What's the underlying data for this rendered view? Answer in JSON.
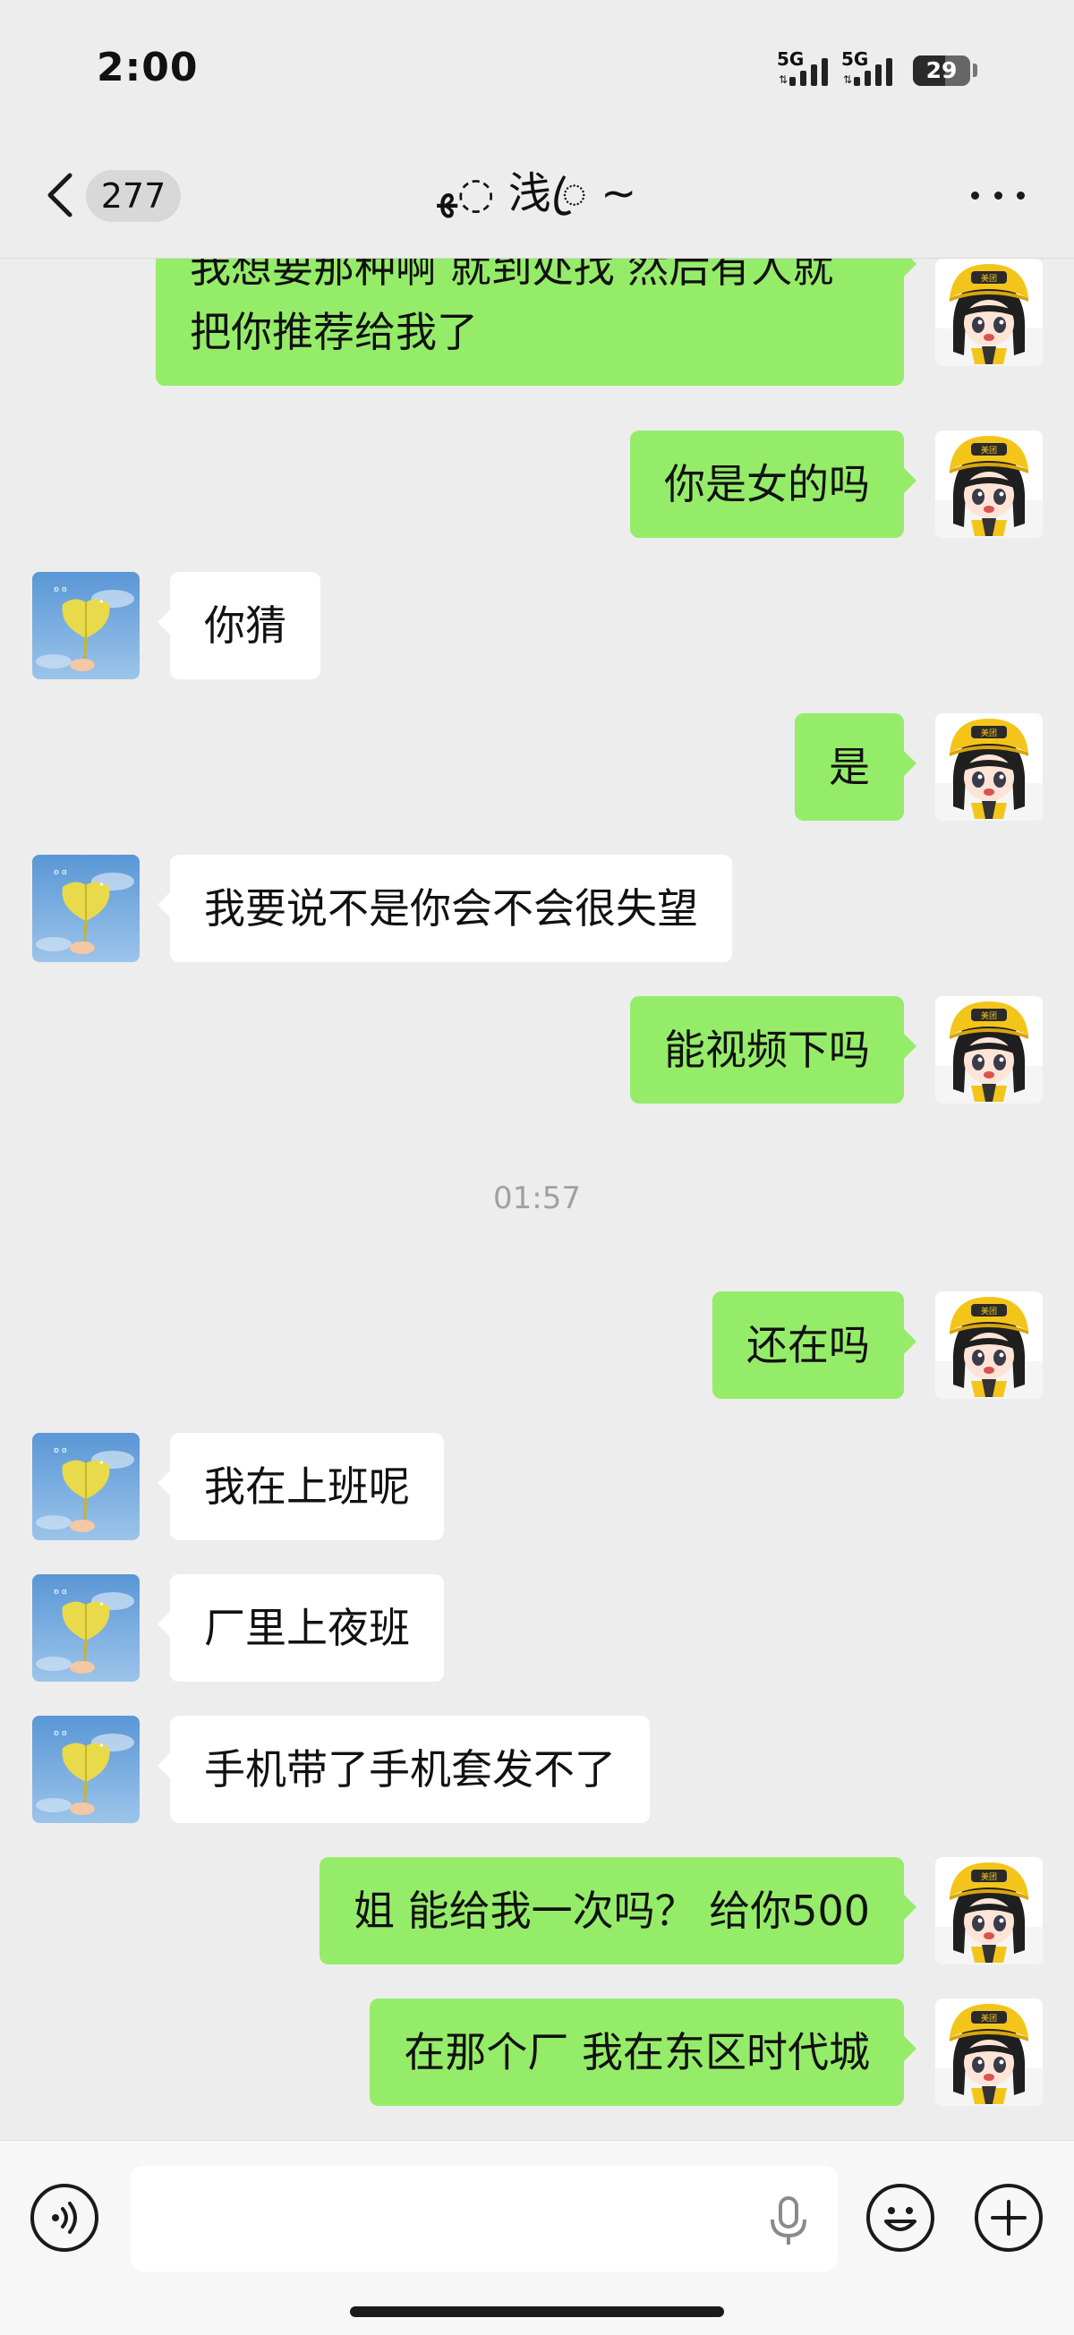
{
  "status_bar": {
    "time": "2:00",
    "sim1_label": "5G",
    "sim2_label": "5G",
    "battery_level": "29"
  },
  "header": {
    "unread_count": "277",
    "title": "ﻬ◌ 浅ꦿ ~"
  },
  "colors": {
    "background": "#ededed",
    "sent_bubble": "#95ec69",
    "received_bubble": "#ffffff",
    "timestamp_text": "#a0a0a0"
  },
  "messages": [
    {
      "from": "me",
      "text": "我想要那种啊 就到处找 然后有人就把你推荐给我了"
    },
    {
      "from": "me",
      "text": "你是女的吗"
    },
    {
      "from": "other",
      "text": "你猜"
    },
    {
      "from": "me",
      "text": "是"
    },
    {
      "from": "other",
      "text": "我要说不是你会不会很失望"
    },
    {
      "from": "me",
      "text": "能视频下吗"
    },
    {
      "timestamp": "01:57"
    },
    {
      "from": "me",
      "text": "还在吗"
    },
    {
      "from": "other",
      "text": "我在上班呢"
    },
    {
      "from": "other",
      "text": "厂里上夜班"
    },
    {
      "from": "other",
      "text": "手机带了手机套发不了"
    },
    {
      "from": "me",
      "text": "姐 能给我一次吗？ 给你500"
    },
    {
      "from": "me",
      "text": "在那个厂 我在东区时代城"
    }
  ],
  "icons": {
    "back": "chevron-left-icon",
    "more": "more-dots-icon",
    "voice": "voice-icon",
    "mic": "microphone-icon",
    "emoji": "emoji-icon",
    "add": "plus-icon",
    "my_avatar": "cartoon-girl-avatar",
    "their_avatar": "ginkgo-leaf-avatar"
  },
  "input": {
    "value": "",
    "placeholder": ""
  }
}
